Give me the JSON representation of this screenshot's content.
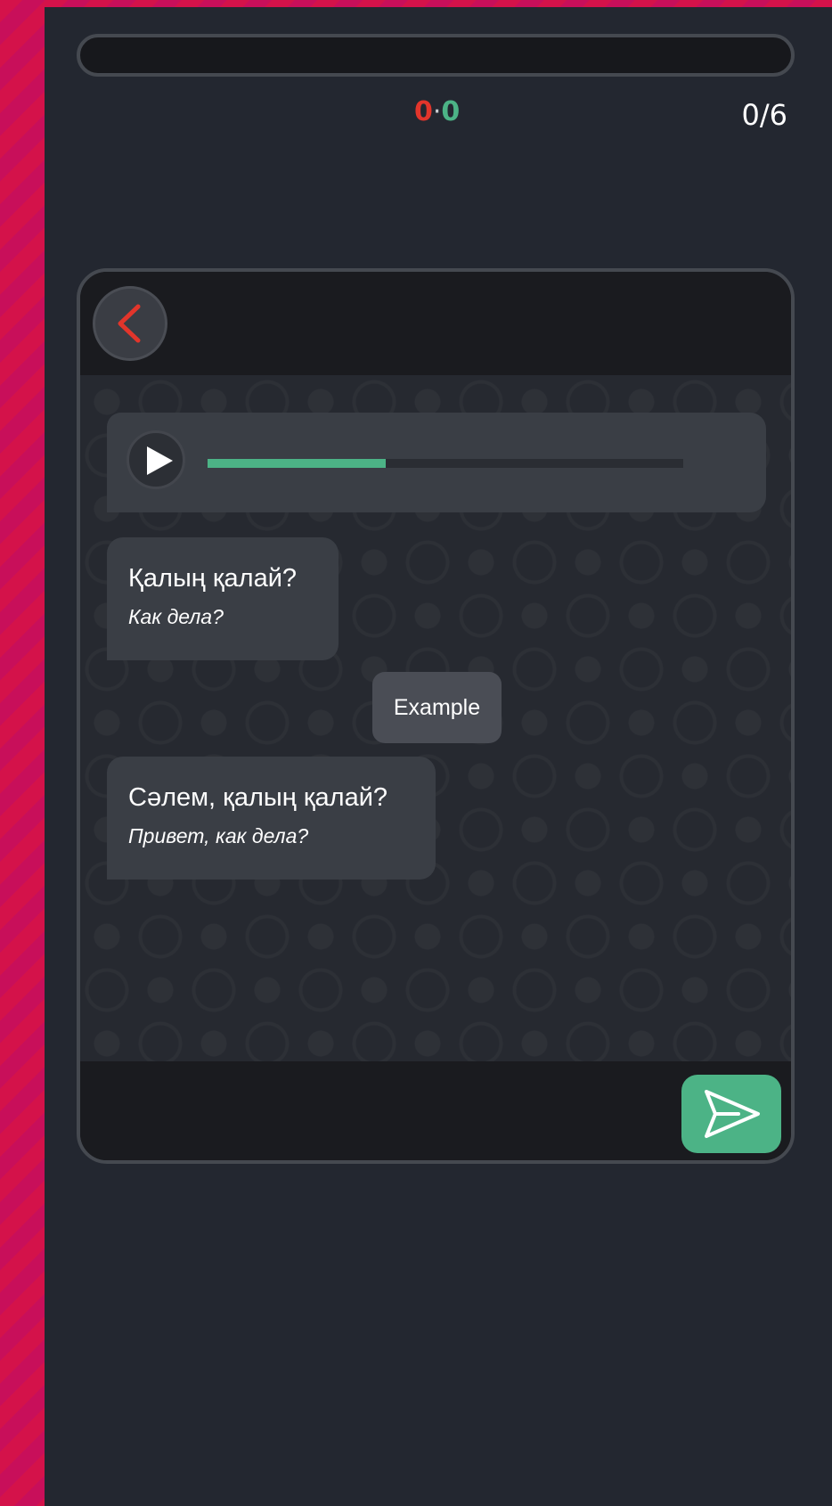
{
  "header": {
    "progress_fraction": 0,
    "score": {
      "wrong": "0",
      "separator": "·",
      "right": "0"
    },
    "counter": "0/6"
  },
  "chat": {
    "back_icon": "chevron-left-icon",
    "audio": {
      "play_icon": "play-icon",
      "progress_fraction": 0.375
    },
    "messages": [
      {
        "text": "Қалың қалай?",
        "translation": "Как дела?"
      },
      {
        "text": "Сәлем, қалың қалай?",
        "translation": "Привет, как дела?"
      }
    ],
    "example_label": "Example",
    "send_icon": "send-icon"
  },
  "colors": {
    "accent_green": "#4cb386",
    "accent_red": "#e2352b",
    "background": "#232730",
    "bubble": "#3a3e45",
    "frame_stripe": "#d4124a"
  }
}
